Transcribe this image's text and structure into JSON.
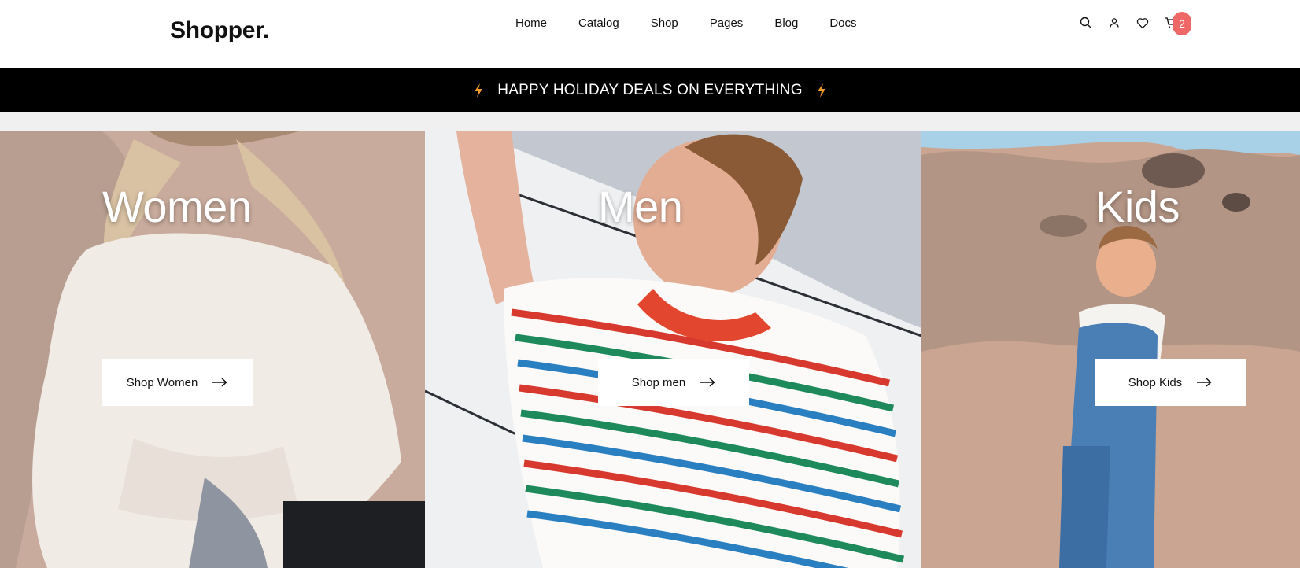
{
  "brand": {
    "logo": "Shopper."
  },
  "nav": {
    "items": [
      {
        "label": "Home"
      },
      {
        "label": "Catalog"
      },
      {
        "label": "Shop"
      },
      {
        "label": "Pages"
      },
      {
        "label": "Blog"
      },
      {
        "label": "Docs"
      }
    ]
  },
  "header_icons": {
    "search": "search-icon",
    "account": "user-icon",
    "wishlist": "heart-icon",
    "cart": "cart-icon",
    "cart_count": "2"
  },
  "promo": {
    "text": "HAPPY HOLIDAY DEALS ON EVERYTHING",
    "icon": "lightning-icon",
    "icon_color": "#f29b2c"
  },
  "categories": [
    {
      "title": "Women",
      "button_label": "Shop Women"
    },
    {
      "title": "Men",
      "button_label": "Shop men"
    },
    {
      "title": "Kids",
      "button_label": "Shop Kids"
    }
  ],
  "colors": {
    "badge": "#ef6868",
    "promo_bg": "#000000"
  }
}
